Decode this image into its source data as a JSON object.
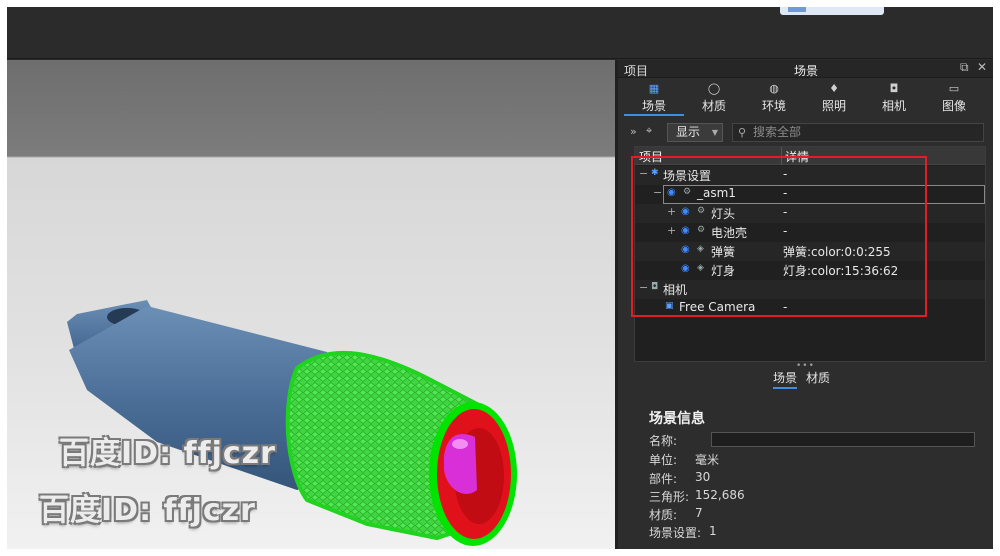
{
  "panel": {
    "title_left": "项目",
    "title_center": "场景",
    "restore_glyph": "⧉",
    "close_glyph": "✕",
    "tabs": [
      {
        "label": "场景",
        "icon": "scene-icon"
      },
      {
        "label": "材质",
        "icon": "material-icon"
      },
      {
        "label": "环境",
        "icon": "environment-icon"
      },
      {
        "label": "照明",
        "icon": "lighting-icon"
      },
      {
        "label": "相机",
        "icon": "camera-icon"
      },
      {
        "label": "图像",
        "icon": "image-icon"
      }
    ],
    "toolbar": {
      "expand_glyph": "»",
      "display_label": "显示",
      "search_placeholder": "搜索全部"
    },
    "tree": {
      "col_item": "项目",
      "col_detail": "详情",
      "rows": [
        {
          "name": "场景设置",
          "detail": "-"
        },
        {
          "name": "_asm1",
          "detail": "-"
        },
        {
          "name": "灯头",
          "detail": "-"
        },
        {
          "name": "电池壳",
          "detail": "-"
        },
        {
          "name": "弹簧",
          "detail": "弹簧:color:0:0:255"
        },
        {
          "name": "灯身",
          "detail": "灯身:color:15:36:62"
        },
        {
          "name": "相机",
          "detail": ""
        },
        {
          "name": "Free Camera",
          "detail": "-"
        }
      ]
    },
    "subtabs": [
      "场景",
      "材质"
    ],
    "info": {
      "title": "场景信息",
      "name_label": "名称:",
      "name_value": "",
      "unit_label": "单位:",
      "unit_value": "毫米",
      "parts_label": "部件:",
      "parts_value": "30",
      "tri_label": "三角形:",
      "tri_value": "152,686",
      "mat_label": "材质:",
      "mat_value": "7",
      "set_label": "场景设置:",
      "set_value": "1"
    }
  },
  "watermark": "百度ID: ffjczr",
  "colors": {
    "selection_box": "#e21d26",
    "accent": "#3e8fe0",
    "eye": "#3d8bff"
  }
}
